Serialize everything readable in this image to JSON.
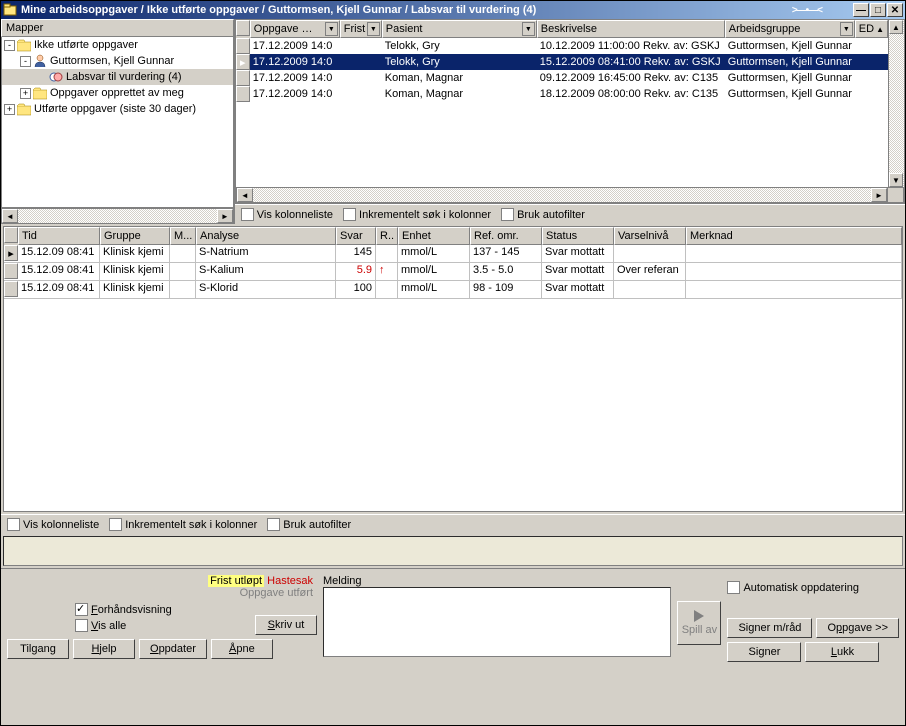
{
  "titlebar": "Mine arbeidsoppgaver / Ikke utførte oppgaver / Guttormsen, Kjell Gunnar / Labsvar til vurdering (4)",
  "mapper_label": "Mapper",
  "tree": [
    {
      "depth": 0,
      "toggle": "-",
      "icon": "folder",
      "label": "Ikke utførte oppgaver"
    },
    {
      "depth": 1,
      "toggle": "-",
      "icon": "person",
      "label": "Guttormsen, Kjell Gunnar"
    },
    {
      "depth": 2,
      "toggle": "",
      "icon": "lab",
      "label": "Labsvar til vurdering (4)",
      "selected": true
    },
    {
      "depth": 1,
      "toggle": "+",
      "icon": "folder",
      "label": "Oppgaver opprettet av meg"
    },
    {
      "depth": 0,
      "toggle": "+",
      "icon": "folder",
      "label": "Utførte oppgaver (siste 30 dager)"
    }
  ],
  "task_headers": {
    "oppgave": "Oppgave …",
    "frist": "Frist",
    "pasient": "Pasient",
    "beskrivelse": "Beskrivelse",
    "arbeidsgruppe": "Arbeidsgruppe",
    "ed": "ED"
  },
  "task_rows": [
    {
      "oppgave": "17.12.2009 14:0",
      "frist": "",
      "pasient": "Telokk, Gry",
      "beskrivelse": "10.12.2009 11:00:00 Rekv. av: GSKJ",
      "arbeidsgruppe": "Guttormsen, Kjell Gunnar",
      "selected": false
    },
    {
      "oppgave": "17.12.2009 14:0",
      "frist": "",
      "pasient": "Telokk, Gry",
      "beskrivelse": "15.12.2009 08:41:00 Rekv. av: GSKJ",
      "arbeidsgruppe": "Guttormsen, Kjell Gunnar",
      "selected": true
    },
    {
      "oppgave": "17.12.2009 14:0",
      "frist": "",
      "pasient": "Koman, Magnar",
      "beskrivelse": "09.12.2009 16:45:00 Rekv. av: C135",
      "arbeidsgruppe": "Guttormsen, Kjell Gunnar",
      "selected": false
    },
    {
      "oppgave": "17.12.2009 14:0",
      "frist": "",
      "pasient": "Koman, Magnar",
      "beskrivelse": "18.12.2009 08:00:00 Rekv. av: C135",
      "arbeidsgruppe": "Guttormsen, Kjell Gunnar",
      "selected": false
    }
  ],
  "filter_labels": {
    "vis_kolonneliste": "Vis kolonneliste",
    "inkrementelt": "Inkrementelt søk i kolonner",
    "bruk_autofilter": "Bruk autofilter"
  },
  "lab_headers": {
    "tid": "Tid",
    "gruppe": "Gruppe",
    "m": "M...",
    "analyse": "Analyse",
    "svar": "Svar",
    "r": "R..",
    "enhet": "Enhet",
    "ref": "Ref. omr.",
    "status": "Status",
    "varsel": "Varselnivå",
    "merknad": "Merknad"
  },
  "lab_rows": [
    {
      "tid": "15.12.09 08:41",
      "gruppe": "Klinisk kjemi",
      "m": "",
      "analyse": "S-Natrium",
      "svar": "145",
      "r": "",
      "enhet": "mmol/L",
      "ref": "137 - 145",
      "status": "Svar mottatt",
      "varsel": "",
      "abnormal": false
    },
    {
      "tid": "15.12.09 08:41",
      "gruppe": "Klinisk kjemi",
      "m": "",
      "analyse": "S-Kalium",
      "svar": "5.9",
      "r": "↑",
      "enhet": "mmol/L",
      "ref": "3.5 - 5.0",
      "status": "Svar mottatt",
      "varsel": "Over referan",
      "abnormal": true
    },
    {
      "tid": "15.12.09 08:41",
      "gruppe": "Klinisk kjemi",
      "m": "",
      "analyse": "S-Klorid",
      "svar": "100",
      "r": "",
      "enhet": "mmol/L",
      "ref": "98 - 109",
      "status": "Svar mottatt",
      "varsel": "",
      "abnormal": false
    }
  ],
  "legend": {
    "frist": "Frist utløpt",
    "haste": "Hastesak",
    "utfort": "Oppgave utført"
  },
  "checkboxes": {
    "forhandsvisning": "Forhåndsvisning",
    "vis_alle": "Vis alle",
    "automatisk": "Automatisk oppdatering"
  },
  "buttons": {
    "tilgang": "Tilgang",
    "hjelp": "Hjelp",
    "oppdater": "Oppdater",
    "skriv_ut": "Skriv ut",
    "apne": "Åpne",
    "spill_av": "Spill av",
    "signer_mrad": "Signer m/råd",
    "oppgave": "Oppgave >>",
    "signer": "Signer",
    "lukk": "Lukk"
  },
  "melding_label": "Melding"
}
